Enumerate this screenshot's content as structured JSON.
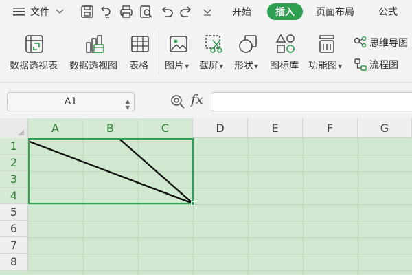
{
  "menubar": {
    "menu_label": "文件",
    "tabs": [
      {
        "label": "开始",
        "active": false
      },
      {
        "label": "插入",
        "active": true
      },
      {
        "label": "页面布局",
        "active": false
      },
      {
        "label": "公式",
        "active": false
      }
    ],
    "accent": "#2e9e4f"
  },
  "ribbon": {
    "tools": [
      {
        "label": "数据透视表",
        "icon": "pivot-table-icon"
      },
      {
        "label": "数据透视图",
        "icon": "pivot-chart-icon"
      },
      {
        "label": "表格",
        "icon": "table-icon"
      },
      {
        "label": "图片",
        "icon": "picture-icon",
        "dropdown": true
      },
      {
        "label": "截屏",
        "icon": "screenshot-icon",
        "dropdown": true
      },
      {
        "label": "形状",
        "icon": "shape-icon",
        "dropdown": true
      },
      {
        "label": "图标库",
        "icon": "icon-library-icon"
      },
      {
        "label": "功能图",
        "icon": "function-chart-icon",
        "dropdown": true
      }
    ],
    "small_tools": [
      {
        "label": "思维导图",
        "icon": "mind-map-icon"
      },
      {
        "label": "流程图",
        "icon": "flowchart-icon"
      }
    ]
  },
  "formula": {
    "cell_ref": "A1",
    "fx_label": "fx",
    "value": ""
  },
  "grid": {
    "columns": [
      "A",
      "B",
      "C",
      "D",
      "E",
      "F",
      "G"
    ],
    "rows": [
      "1",
      "2",
      "3",
      "4",
      "5",
      "6",
      "7",
      "8"
    ],
    "selected_range": "A1:C4",
    "cell_fill": "#cfe8cf",
    "selection_color": "#2e9e4f"
  }
}
